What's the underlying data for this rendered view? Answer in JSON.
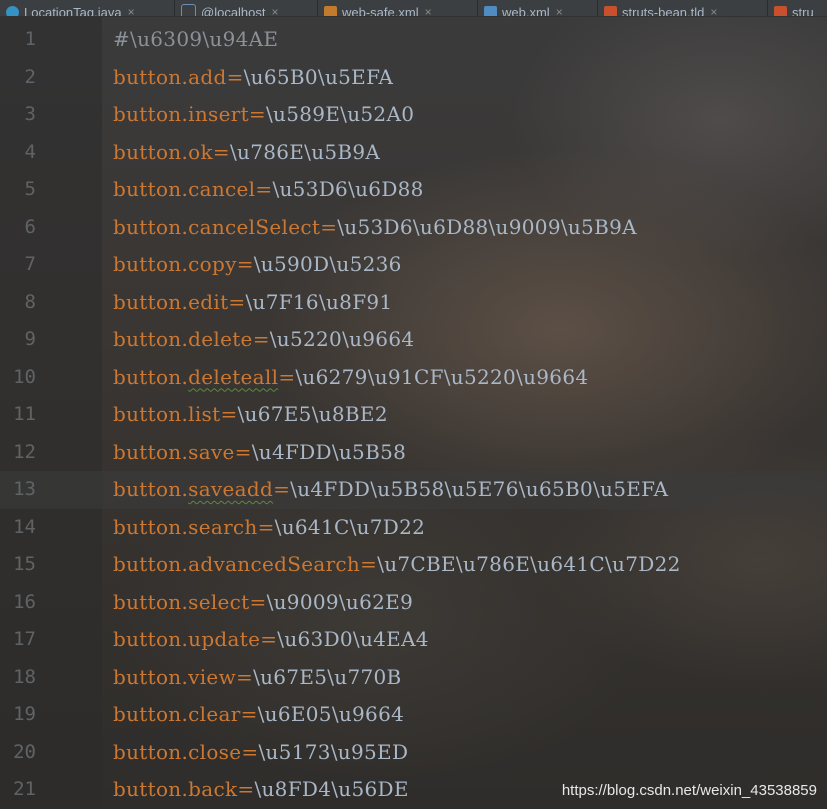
{
  "tabs": [
    {
      "label": "LocationTag.java",
      "icon": "class-icon"
    },
    {
      "label": "@localhost",
      "icon": "database-icon"
    },
    {
      "label": "web-safe.xml",
      "icon": "xml-file-icon"
    },
    {
      "label": "web.xml",
      "icon": "xml-file-icon"
    },
    {
      "label": "struts-bean.tld",
      "icon": "tld-file-icon"
    },
    {
      "label": "stru",
      "icon": "tld-file-icon"
    }
  ],
  "tab_close_glyph": "×",
  "editor": {
    "current_line": 13,
    "lines": [
      {
        "num": "1",
        "comment": "#\\u6309\\u94AE"
      },
      {
        "num": "2",
        "prefix": "button.",
        "key": "add",
        "eq": "=",
        "value": "\\u65B0\\u5EFA"
      },
      {
        "num": "3",
        "prefix": "button.",
        "key": "insert",
        "eq": "=",
        "value": "\\u589E\\u52A0"
      },
      {
        "num": "4",
        "prefix": "button.",
        "key": "ok",
        "eq": "=",
        "value": "\\u786E\\u5B9A"
      },
      {
        "num": "5",
        "prefix": "button.",
        "key": "cancel",
        "eq": "=",
        "value": "\\u53D6\\u6D88"
      },
      {
        "num": "6",
        "prefix": "button.",
        "key": "cancelSelect",
        "eq": "=",
        "value": "\\u53D6\\u6D88\\u9009\\u5B9A"
      },
      {
        "num": "7",
        "prefix": "button.",
        "key": "copy",
        "eq": "=",
        "value": "\\u590D\\u5236"
      },
      {
        "num": "8",
        "prefix": "button.",
        "key": "edit",
        "eq": "=",
        "value": "\\u7F16\\u8F91"
      },
      {
        "num": "9",
        "prefix": "button.",
        "key": "delete",
        "eq": "=",
        "value": "\\u5220\\u9664"
      },
      {
        "num": "10",
        "prefix": "button.",
        "key": "deleteall",
        "eq": "=",
        "value": "\\u6279\\u91CF\\u5220\\u9664",
        "squiggle": true
      },
      {
        "num": "11",
        "prefix": "button.",
        "key": "list",
        "eq": "=",
        "value": "\\u67E5\\u8BE2"
      },
      {
        "num": "12",
        "prefix": "button.",
        "key": "save",
        "eq": "=",
        "value": "\\u4FDD\\u5B58"
      },
      {
        "num": "13",
        "prefix": "button.",
        "key": "saveadd",
        "eq": "=",
        "value": "\\u4FDD\\u5B58\\u5E76\\u65B0\\u5EFA",
        "squiggle": true
      },
      {
        "num": "14",
        "prefix": "button.",
        "key": "search",
        "eq": "=",
        "value": "\\u641C\\u7D22"
      },
      {
        "num": "15",
        "prefix": "button.",
        "key": "advancedSearch",
        "eq": "=",
        "value": "\\u7CBE\\u786E\\u641C\\u7D22"
      },
      {
        "num": "16",
        "prefix": "button.",
        "key": "select",
        "eq": "=",
        "value": "\\u9009\\u62E9"
      },
      {
        "num": "17",
        "prefix": "button.",
        "key": "update",
        "eq": "=",
        "value": "\\u63D0\\u4EA4"
      },
      {
        "num": "18",
        "prefix": "button.",
        "key": "view",
        "eq": "=",
        "value": "\\u67E5\\u770B"
      },
      {
        "num": "19",
        "prefix": "button.",
        "key": "clear",
        "eq": "=",
        "value": "\\u6E05\\u9664"
      },
      {
        "num": "20",
        "prefix": "button.",
        "key": "close",
        "eq": "=",
        "value": "\\u5173\\u95ED"
      },
      {
        "num": "21",
        "prefix": "button.",
        "key": "back",
        "eq": "=",
        "value": "\\u8FD4\\u56DE"
      }
    ]
  },
  "watermark": "https://blog.csdn.net/weixin_43538859",
  "colors": {
    "key": "#cc7832",
    "value": "#a9b7c6",
    "line_number": "#5f6366",
    "comment": "#8a9199"
  }
}
